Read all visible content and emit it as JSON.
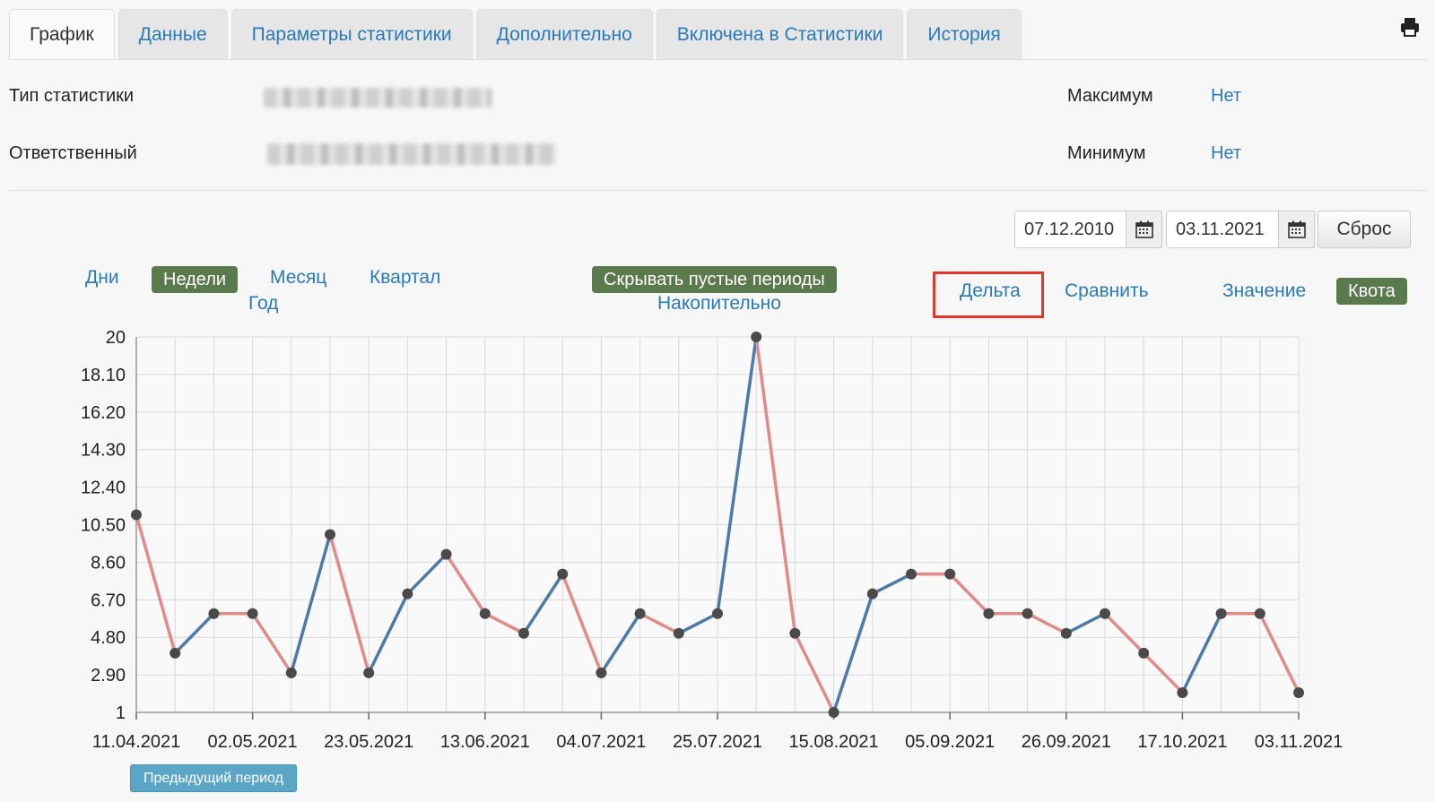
{
  "tabs": [
    {
      "label": "График",
      "active": true
    },
    {
      "label": "Данные"
    },
    {
      "label": "Параметры статистики"
    },
    {
      "label": "Дополнительно"
    },
    {
      "label": "Включена в Статистики"
    },
    {
      "label": "История"
    }
  ],
  "info": {
    "type_label": "Тип статистики",
    "owner_label": "Ответственный",
    "max_label": "Максимум",
    "max_value": "Нет",
    "min_label": "Минимум",
    "min_value": "Нет"
  },
  "date_range": {
    "from": "07.12.2010",
    "to": "03.11.2021",
    "reset_label": "Сброс"
  },
  "periods": {
    "days": "Дни",
    "weeks": "Недели",
    "month": "Месяц",
    "quarter": "Квартал",
    "year": "Год",
    "selected": "weeks"
  },
  "options": {
    "hide_empty": "Скрывать пустые периоды",
    "cumulative": "Накопительно"
  },
  "modes": {
    "delta": "Дельта",
    "compare": "Сравнить",
    "value": "Значение",
    "quota": "Квота"
  },
  "prev_period_label": "Предыдущий период",
  "colors": {
    "up": "#4d7aa8",
    "down": "#e08a89",
    "point": "#4a4a4a",
    "grid": "#d9d9d9",
    "toggle_on": "#5a7a4e",
    "link": "#2a7ab8"
  },
  "chart_data": {
    "type": "line",
    "x": [
      "11.04.2021",
      "18.04.2021",
      "25.04.2021",
      "02.05.2021",
      "09.05.2021",
      "16.05.2021",
      "23.05.2021",
      "30.05.2021",
      "06.06.2021",
      "13.06.2021",
      "20.06.2021",
      "27.06.2021",
      "04.07.2021",
      "11.07.2021",
      "18.07.2021",
      "25.07.2021",
      "01.08.2021",
      "08.08.2021",
      "15.08.2021",
      "22.08.2021",
      "29.08.2021",
      "05.09.2021",
      "12.09.2021",
      "19.09.2021",
      "26.09.2021",
      "03.10.2021",
      "10.10.2021",
      "17.10.2021",
      "24.10.2021",
      "31.10.2021",
      "03.11.2021"
    ],
    "values": [
      11,
      4,
      6,
      6,
      3,
      10,
      3,
      7,
      9,
      6,
      5,
      8,
      3,
      6,
      5,
      6,
      20,
      5,
      1,
      7,
      8,
      8,
      6,
      6,
      5,
      6,
      4,
      2,
      6,
      6,
      2
    ],
    "x_tick_labels": [
      "11.04.2021",
      "02.05.2021",
      "23.05.2021",
      "13.06.2021",
      "04.07.2021",
      "25.07.2021",
      "15.08.2021",
      "05.09.2021",
      "26.09.2021",
      "17.10.2021",
      "03.11.2021"
    ],
    "y_ticks": [
      "1",
      "2.90",
      "4.80",
      "6.70",
      "8.60",
      "10.50",
      "12.40",
      "14.30",
      "16.20",
      "18.10",
      "20"
    ],
    "ylim": [
      1,
      20
    ],
    "grid": true,
    "segment_colors": "rising segments blue, falling and flat segments red"
  }
}
